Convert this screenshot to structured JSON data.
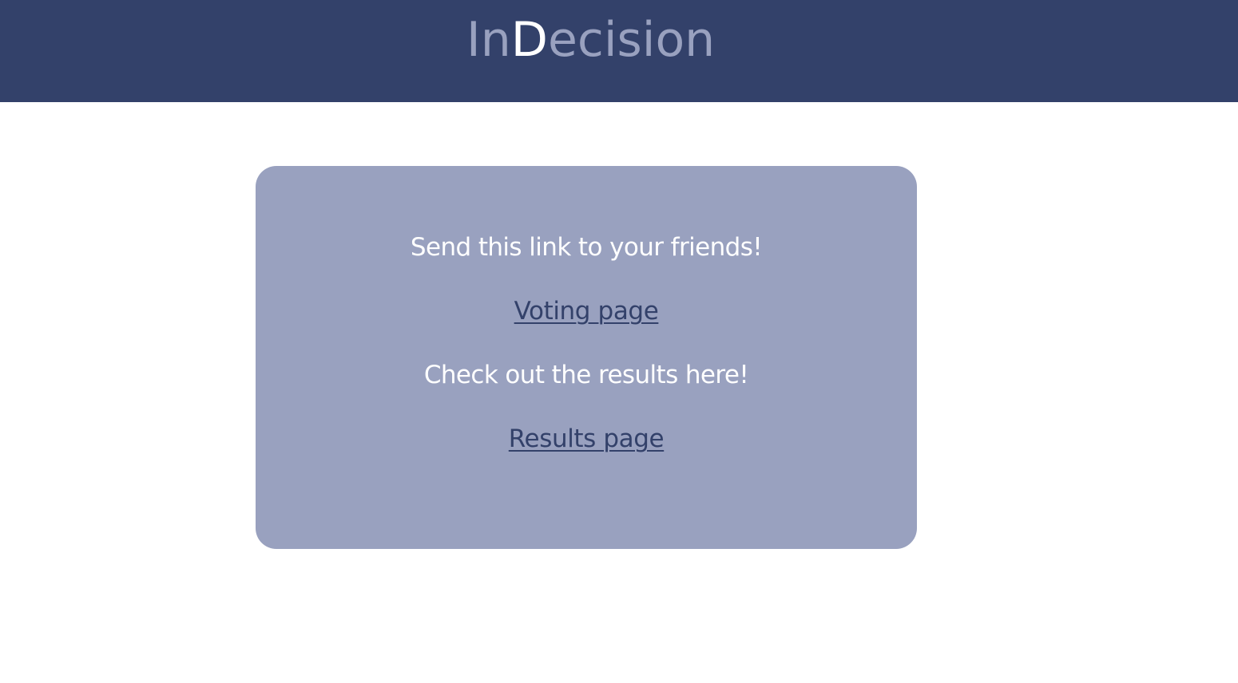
{
  "header": {
    "logo_prefix": "In",
    "logo_highlight": "D",
    "logo_suffix": "ecision"
  },
  "card": {
    "share_message": "Send this link to your friends!",
    "voting_link_label": "Voting page",
    "results_message": "Check out the results here!",
    "results_link_label": "Results page"
  },
  "colors": {
    "header_background": "#33416a",
    "card_background": "#99a1bf",
    "logo_dim": "#99a1bf",
    "logo_bright": "#ffffff",
    "link": "#33416a",
    "message_text": "#ffffff"
  }
}
